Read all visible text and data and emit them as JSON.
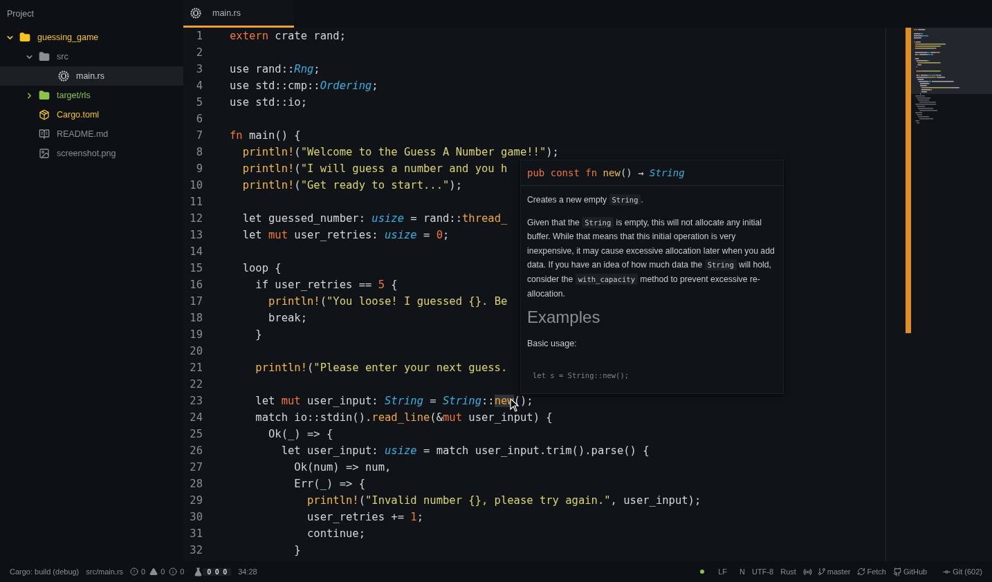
{
  "sidebar": {
    "title": "Project",
    "tree": [
      {
        "label": "guessing_game",
        "kind": "folder",
        "expanded": true,
        "selected": false,
        "color": "#f5c518",
        "children": [
          {
            "label": "src",
            "kind": "folder",
            "expanded": true,
            "selected": false,
            "color": "#8a8f96",
            "children": [
              {
                "label": "main.rs",
                "kind": "rust-file",
                "selected": true,
                "color": "#c8ccd0"
              }
            ]
          },
          {
            "label": "target/rls",
            "kind": "folder",
            "expanded": false,
            "selected": false,
            "color": "#8bc34a"
          },
          {
            "label": "Cargo.toml",
            "kind": "manifest",
            "selected": false,
            "color": "#f5c518"
          },
          {
            "label": "README.md",
            "kind": "doc",
            "selected": false,
            "color": "#8a8f96"
          },
          {
            "label": "screenshot.png",
            "kind": "image",
            "selected": false,
            "color": "#8a8f96"
          }
        ]
      }
    ]
  },
  "tabs": [
    {
      "label": "main.rs",
      "selected": true
    }
  ],
  "editor": {
    "lines": [
      {
        "number": "1",
        "tokens": [
          {
            "kind": "keyword",
            "text": "extern"
          },
          {
            "kind": "plain",
            "text": " crate rand;"
          }
        ]
      },
      {
        "number": "2"
      },
      {
        "number": "3",
        "tokens": [
          {
            "kind": "plain",
            "text": "use rand::"
          },
          {
            "kind": "type",
            "text": "Rng"
          },
          {
            "kind": "plain",
            "text": ";"
          }
        ]
      },
      {
        "number": "4",
        "tokens": [
          {
            "kind": "plain",
            "text": "use std::cmp::"
          },
          {
            "kind": "type",
            "text": "Ordering"
          },
          {
            "kind": "plain",
            "text": ";"
          }
        ]
      },
      {
        "number": "5",
        "tokens": [
          {
            "kind": "plain",
            "text": "use std::io;"
          }
        ]
      },
      {
        "number": "6"
      },
      {
        "number": "7",
        "tokens": [
          {
            "kind": "keyword",
            "text": "fn"
          },
          {
            "kind": "plain",
            "text": " main() {"
          }
        ]
      },
      {
        "number": "8",
        "tokens": [
          {
            "kind": "macro",
            "text": "  println!"
          },
          {
            "kind": "plain",
            "text": "("
          },
          {
            "kind": "string",
            "text": "\"Welcome to the Guess A Number game!!\""
          },
          {
            "kind": "plain",
            "text": ");"
          }
        ]
      },
      {
        "number": "9",
        "tokens": [
          {
            "kind": "macro",
            "text": "  println!"
          },
          {
            "kind": "plain",
            "text": "("
          },
          {
            "kind": "string",
            "text": "\"I will guess a number and you h"
          }
        ]
      },
      {
        "number": "10",
        "tokens": [
          {
            "kind": "macro",
            "text": "  println!"
          },
          {
            "kind": "plain",
            "text": "("
          },
          {
            "kind": "string",
            "text": "\"Get ready to start...\""
          },
          {
            "kind": "plain",
            "text": ");"
          }
        ]
      },
      {
        "number": "11"
      },
      {
        "number": "12",
        "tokens": [
          {
            "kind": "plain",
            "text": "  let guessed_number: "
          },
          {
            "kind": "type",
            "text": "usize"
          },
          {
            "kind": "plain",
            "text": " = rand::"
          },
          {
            "kind": "function",
            "text": "thread_"
          }
        ]
      },
      {
        "number": "13",
        "tokens": [
          {
            "kind": "plain",
            "text": "  let "
          },
          {
            "kind": "keyword",
            "text": "mut"
          },
          {
            "kind": "plain",
            "text": " user_retries: "
          },
          {
            "kind": "type",
            "text": "usize"
          },
          {
            "kind": "plain",
            "text": " = "
          },
          {
            "kind": "number",
            "text": "0"
          },
          {
            "kind": "plain",
            "text": ";"
          }
        ]
      },
      {
        "number": "14"
      },
      {
        "number": "15",
        "tokens": [
          {
            "kind": "plain",
            "text": "  loop {"
          }
        ]
      },
      {
        "number": "16",
        "tokens": [
          {
            "kind": "plain",
            "text": "    if user_retries == "
          },
          {
            "kind": "number",
            "text": "5"
          },
          {
            "kind": "plain",
            "text": " {"
          }
        ]
      },
      {
        "number": "17",
        "tokens": [
          {
            "kind": "macro",
            "text": "      println!"
          },
          {
            "kind": "plain",
            "text": "("
          },
          {
            "kind": "string",
            "text": "\"You loose! I guessed {}. Be"
          }
        ]
      },
      {
        "number": "18",
        "tokens": [
          {
            "kind": "plain",
            "text": "      break;"
          }
        ]
      },
      {
        "number": "19",
        "tokens": [
          {
            "kind": "plain",
            "text": "    }"
          }
        ]
      },
      {
        "number": "20"
      },
      {
        "number": "21",
        "tokens": [
          {
            "kind": "macro",
            "text": "    println!"
          },
          {
            "kind": "plain",
            "text": "("
          },
          {
            "kind": "string",
            "text": "\"Please enter your next guess."
          }
        ]
      },
      {
        "number": "22"
      },
      {
        "number": "23",
        "tokens": [
          {
            "kind": "plain",
            "text": "    let "
          },
          {
            "kind": "keyword",
            "text": "mut"
          },
          {
            "kind": "plain",
            "text": " user_input: "
          },
          {
            "kind": "type",
            "text": "String"
          },
          {
            "kind": "plain",
            "text": " = "
          },
          {
            "kind": "type",
            "text": "String"
          },
          {
            "kind": "plain",
            "text": "::"
          },
          {
            "kind": "function",
            "text": "new",
            "highlighted": true
          },
          {
            "kind": "plain",
            "text": "();"
          }
        ]
      },
      {
        "number": "24",
        "tokens": [
          {
            "kind": "plain",
            "text": "    match io::stdin()."
          },
          {
            "kind": "function",
            "text": "read_line"
          },
          {
            "kind": "plain",
            "text": "(&"
          },
          {
            "kind": "keyword",
            "text": "mut"
          },
          {
            "kind": "plain",
            "text": " user_input) {"
          }
        ]
      },
      {
        "number": "25",
        "tokens": [
          {
            "kind": "plain",
            "text": "      Ok(_) => {"
          }
        ]
      },
      {
        "number": "26",
        "tokens": [
          {
            "kind": "plain",
            "text": "        let user_input: "
          },
          {
            "kind": "type",
            "text": "usize"
          },
          {
            "kind": "plain",
            "text": " = match user_input.trim().parse() {"
          }
        ]
      },
      {
        "number": "27",
        "tokens": [
          {
            "kind": "plain",
            "text": "          Ok(num) => num,"
          }
        ]
      },
      {
        "number": "28",
        "tokens": [
          {
            "kind": "plain",
            "text": "          Err(_) => {"
          }
        ]
      },
      {
        "number": "29",
        "tokens": [
          {
            "kind": "macro",
            "text": "            println!"
          },
          {
            "kind": "plain",
            "text": "("
          },
          {
            "kind": "string",
            "text": "\"Invalid number {}, please try again.\""
          },
          {
            "kind": "plain",
            "text": ", user_input);"
          }
        ]
      },
      {
        "number": "30",
        "tokens": [
          {
            "kind": "plain",
            "text": "            user_retries += "
          },
          {
            "kind": "number",
            "text": "1"
          },
          {
            "kind": "plain",
            "text": ";"
          }
        ]
      },
      {
        "number": "31",
        "tokens": [
          {
            "kind": "plain",
            "text": "            continue;"
          }
        ]
      },
      {
        "number": "32",
        "tokens": [
          {
            "kind": "plain",
            "text": "          }"
          }
        ]
      }
    ],
    "hover_popup": {
      "signature": [
        {
          "kind": "keyword",
          "text": "pub const fn"
        },
        {
          "kind": "macro",
          "text": " new"
        },
        {
          "kind": "plain",
          "text": "() → "
        },
        {
          "kind": "type",
          "text": "String"
        }
      ],
      "paragraphs": [
        [
          {
            "text": "Creates a new empty ",
            "code": false
          },
          {
            "text": "String",
            "code": true
          },
          {
            "text": ".",
            "code": false
          }
        ],
        [
          {
            "text": "Given that the ",
            "code": false
          },
          {
            "text": "String",
            "code": true
          },
          {
            "text": " is empty, this will not allocate any initial buffer. While that means that this initial operation is very inexpensive, it may cause excessive allocation later when you add data. If you have an idea of how much data the ",
            "code": false
          },
          {
            "text": "String",
            "code": true
          },
          {
            "text": " will hold, consider the ",
            "code": false
          },
          {
            "text": "with_capacity",
            "code": true
          },
          {
            "text": " method to prevent excessive re-allocation.",
            "code": false
          }
        ]
      ],
      "heading": "Examples",
      "subtitle": "Basic usage:",
      "example": "let s = String::new();"
    }
  },
  "status_bar": {
    "build": "Cargo: build (debug)",
    "file": "src/main.rs",
    "errors": "0",
    "warnings": "0",
    "infos": "0",
    "tests": [
      "0",
      "0",
      "0"
    ],
    "cursor": "34:28",
    "line_ending": "LF",
    "mode": "N",
    "encoding": "UTF-8",
    "grammar": "Rust",
    "branch": "master",
    "fetch": "Fetch",
    "github": "GitHub",
    "git": "Git (602)"
  }
}
